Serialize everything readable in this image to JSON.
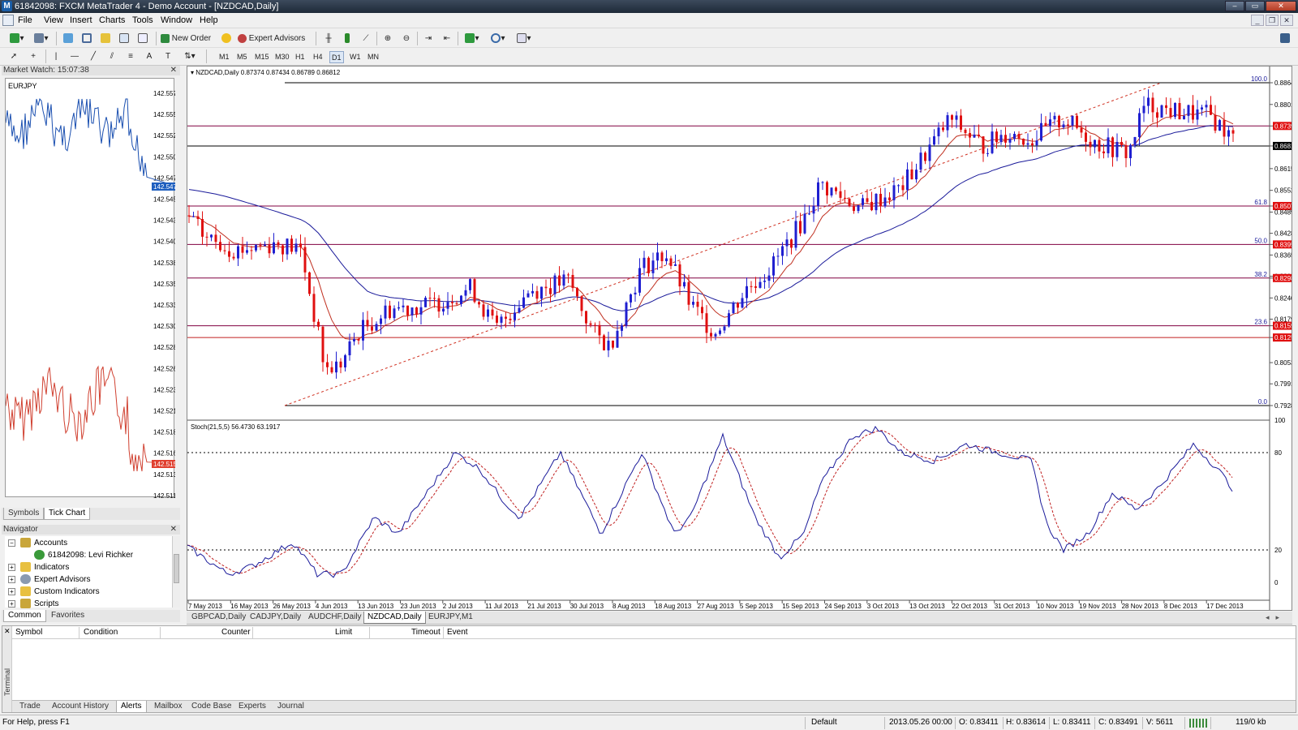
{
  "window": {
    "title": "61842098: FXCM MetaTrader 4 - Demo Account - [NZDCAD,Daily]"
  },
  "menu": [
    "File",
    "View",
    "Insert",
    "Charts",
    "Tools",
    "Window",
    "Help"
  ],
  "toolbar": {
    "new_order": "New Order",
    "expert_advisors": "Expert Advisors"
  },
  "timeframes": [
    "M1",
    "M5",
    "M15",
    "M30",
    "H1",
    "H4",
    "D1",
    "W1",
    "MN"
  ],
  "active_timeframe": "D1",
  "market_watch": {
    "header": "Market Watch: 15:07:38",
    "symbol": "EURJPY",
    "price_labels": [
      "142.557",
      "142.555",
      "142.552",
      "142.550",
      "142.547",
      "142.545",
      "142.543",
      "142.540",
      "142.538",
      "142.535",
      "142.533",
      "142.530",
      "142.528",
      "142.526",
      "142.523",
      "142.521",
      "142.518",
      "142.516",
      "142.513",
      "142.511"
    ],
    "ask_marker": "142.547",
    "bid_marker": "142.515",
    "tabs": [
      "Symbols",
      "Tick Chart"
    ],
    "active_tab": "Tick Chart"
  },
  "navigator": {
    "header": "Navigator",
    "items": [
      "Accounts",
      "61842098: Levi Richker",
      "Indicators",
      "Expert Advisors",
      "Custom Indicators",
      "Scripts"
    ],
    "tabs": [
      "Common",
      "Favorites"
    ]
  },
  "chart": {
    "symbol_header": "NZDCAD,Daily  0.87374 0.87434 0.86789 0.86812",
    "indicator_header": "Stoch(21,5,5) 56.4730 63.1917",
    "price_axis": [
      "0.88645",
      "0.88015",
      "0.87392",
      "0.86812",
      "0.86155",
      "0.85525",
      "0.85071",
      "0.84895",
      "0.84280",
      "0.83957",
      "0.83650",
      "0.83035",
      "0.82982",
      "0.82405",
      "0.81790",
      "0.81599",
      "0.81258",
      "0.80530",
      "0.79915",
      "0.79285"
    ],
    "red_price_labels": [
      "0.87392",
      "0.85071",
      "0.83957",
      "0.82982",
      "0.81599",
      "0.81258"
    ],
    "current_price_label": "0.86812",
    "fib_labels": [
      "100.0",
      "61.8",
      "50.0",
      "38.2",
      "23.6",
      "0.0"
    ],
    "stoch_axis": [
      "100",
      "80",
      "20",
      "0"
    ],
    "date_labels": [
      "7 May 2013",
      "16 May 2013",
      "26 May 2013",
      "4 Jun 2013",
      "13 Jun 2013",
      "23 Jun 2013",
      "2 Jul 2013",
      "11 Jul 2013",
      "21 Jul 2013",
      "30 Jul 2013",
      "8 Aug 2013",
      "18 Aug 2013",
      "27 Aug 2013",
      "5 Sep 2013",
      "15 Sep 2013",
      "24 Sep 2013",
      "3 Oct 2013",
      "13 Oct 2013",
      "22 Oct 2013",
      "31 Oct 2013",
      "10 Nov 2013",
      "19 Nov 2013",
      "28 Nov 2013",
      "8 Dec 2013",
      "17 Dec 2013"
    ],
    "colors": {
      "bull": "#1f1fd0",
      "bear": "#e01010",
      "ma_fast": "#c03020",
      "ma_slow": "#1a1a9a",
      "fib": "#800040"
    }
  },
  "chart_tabs": [
    "GBPCAD,Daily",
    "CADJPY,Daily",
    "AUDCHF,Daily",
    "NZDCAD,Daily",
    "EURJPY,M1"
  ],
  "active_chart_tab": "NZDCAD,Daily",
  "terminal": {
    "side_label": "Terminal",
    "columns": [
      "Symbol",
      "Condition",
      "Counter",
      "Limit",
      "Timeout",
      "Event"
    ],
    "tabs": [
      "Trade",
      "Account History",
      "Alerts",
      "Mailbox",
      "Code Base",
      "Experts",
      "Journal"
    ],
    "active_tab": "Alerts"
  },
  "status": {
    "help": "For Help, press F1",
    "profile": "Default",
    "datetime": "2013.05.26 00:00",
    "open": "O: 0.83411",
    "high": "H: 0.83614",
    "low": "L: 0.83411",
    "close": "C: 0.83491",
    "volume": "V: 5611",
    "traffic": "119/0 kb"
  }
}
